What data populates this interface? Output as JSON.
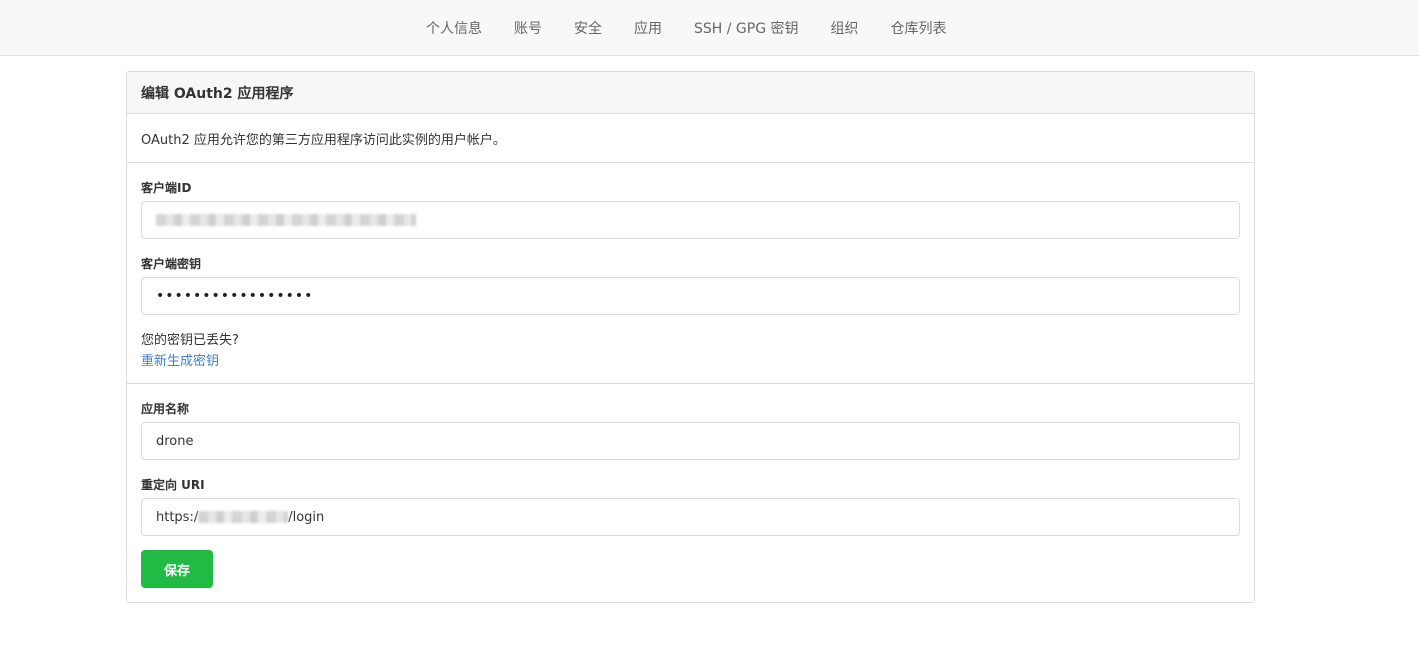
{
  "nav": {
    "items": [
      {
        "label": "个人信息"
      },
      {
        "label": "账号"
      },
      {
        "label": "安全"
      },
      {
        "label": "应用"
      },
      {
        "label": "SSH / GPG 密钥"
      },
      {
        "label": "组织"
      },
      {
        "label": "仓库列表"
      }
    ]
  },
  "panel": {
    "title": "编辑 OAuth2 应用程序",
    "description": "OAuth2 应用允许您的第三方应用程序访问此实例的用户帐户。"
  },
  "client_id": {
    "label": "客户端ID",
    "value_redacted": true
  },
  "client_secret": {
    "label": "客户端密钥",
    "value": "•••••••••••••••••"
  },
  "secret_lost": {
    "text": "您的密钥已丢失?",
    "regenerate_link": "重新生成密钥"
  },
  "app_name": {
    "label": "应用名称",
    "value": "drone"
  },
  "redirect_uri": {
    "label": "重定向 URI",
    "prefix": "https:/",
    "suffix": "/login"
  },
  "actions": {
    "save_label": "保存"
  },
  "colors": {
    "primary_button": "#21ba45",
    "link": "#4183c4",
    "header_bg": "#f7f7f7",
    "nav_bg": "#f8f8f8"
  }
}
